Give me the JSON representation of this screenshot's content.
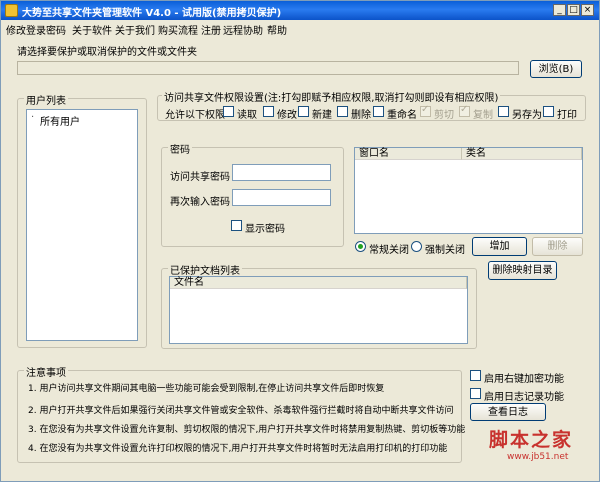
{
  "window": {
    "title": "大势至共享文件夹管理软件 V4.0 - 试用版(禁用拷贝保护)",
    "min": "_",
    "max": "□",
    "close": "×"
  },
  "menu": [
    "修改登录密码",
    "关于软件",
    "关于我们",
    "购买流程",
    "注册",
    "远程协助",
    "帮助"
  ],
  "path_section": {
    "prompt": "请选择要保护或取消保护的文件或文件夹",
    "path_value": "",
    "browse_button": "浏览(B)"
  },
  "users": {
    "group_title": "用户列表",
    "tree_item": "所有用户"
  },
  "permissions": {
    "group_title": "访问共享文件权限设置(注:打勾即赋予相应权限,取消打勾则即设有相应权限)",
    "allow_label": "允许以下权限",
    "items": [
      {
        "label": "读取",
        "checked": false,
        "disabled": false
      },
      {
        "label": "修改",
        "checked": false,
        "disabled": false
      },
      {
        "label": "新建",
        "checked": false,
        "disabled": false
      },
      {
        "label": "删除",
        "checked": false,
        "disabled": false
      },
      {
        "label": "重命名",
        "checked": false,
        "disabled": false
      },
      {
        "label": "剪切",
        "checked": true,
        "disabled": true
      },
      {
        "label": "复制",
        "checked": true,
        "disabled": true
      },
      {
        "label": "另存为",
        "checked": false,
        "disabled": false
      },
      {
        "label": "打印",
        "checked": false,
        "disabled": false
      }
    ]
  },
  "password": {
    "group_title": "密码",
    "access_label": "访问共享密码",
    "access_value": "",
    "confirm_label": "再次输入密码",
    "confirm_value": "",
    "show_label": "显示密码"
  },
  "windows_list": {
    "col1": "窗口名",
    "col2": "类名"
  },
  "close_mode": {
    "normal_label": "常规关闭",
    "force_label": "强制关闭",
    "selected": "normal",
    "add_button": "增加",
    "delete_button": "删除"
  },
  "protected_docs": {
    "group_title": "已保护文档列表",
    "col1": "文件名",
    "remove_mapping_button": "删除映射目录"
  },
  "notes": {
    "group_title": "注意事项",
    "lines": [
      "1. 用户访问共享文件期间其电脑一些功能可能会受到限制,在停止访问共享文件后即时恢复",
      "2. 用户打开共享文件后如果强行关闭共享文件管或安全软件、杀毒软件强行拦截时将自动中断共享文件访问",
      "3. 在您没有为共享文件设置允许复制、剪切权限的情况下,用户打开共享文件时将禁用复制热键、剪切板等功能",
      "4. 在您没有为共享文件设置允许打印权限的情况下,用户打开共享文件时将暂时无法启用打印机的打印功能"
    ]
  },
  "options": {
    "right_click_label": "启用右键加密功能",
    "log_label": "启用日志记录功能",
    "view_log_button": "查看日志"
  },
  "watermark": {
    "text": "脚本之家",
    "url": "www.jb51.net"
  }
}
